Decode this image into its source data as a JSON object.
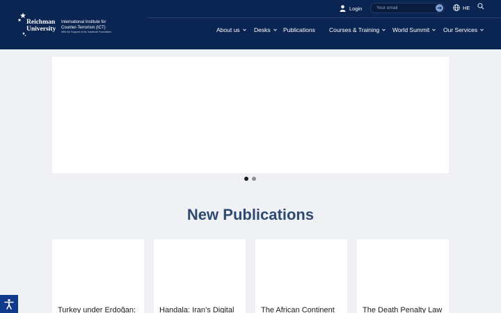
{
  "header": {
    "logo": {
      "university_line1": "Reichman",
      "university_line2": "University",
      "institute_line1": "International Institute for",
      "institute_line2": "Counter-Terrorism (ICT)",
      "support_line": "With the Support of the Jusidman Foundation"
    },
    "login_label": "Login",
    "email_placeholder": "Your email",
    "language_label": "HE",
    "nav": [
      {
        "label": "About us",
        "has_dropdown": true
      },
      {
        "label": "Desks",
        "has_dropdown": true
      },
      {
        "label": "Publications",
        "has_dropdown": false
      },
      {
        "label": "Courses & Training",
        "has_dropdown": true
      },
      {
        "label": "World Summit",
        "has_dropdown": true
      },
      {
        "label": "Our Services",
        "has_dropdown": true
      }
    ]
  },
  "carousel": {
    "slide_count": 2,
    "active_slide": 1
  },
  "publications": {
    "heading": "New Publications",
    "cards": [
      {
        "title": "Turkey under Erdoğan:"
      },
      {
        "title": "Handala: Iran’s Digital"
      },
      {
        "title": "The African Continent"
      },
      {
        "title": "The Death Penalty Law"
      }
    ]
  },
  "colors": {
    "header_bg": "#0b2552",
    "accent": "#7f9ed6",
    "heading": "#2f4a70",
    "page_bg": "#eff1f5"
  },
  "icons": {
    "login": "user-icon",
    "language": "globe-icon",
    "search": "search-icon",
    "accessibility": "accessibility-icon"
  }
}
